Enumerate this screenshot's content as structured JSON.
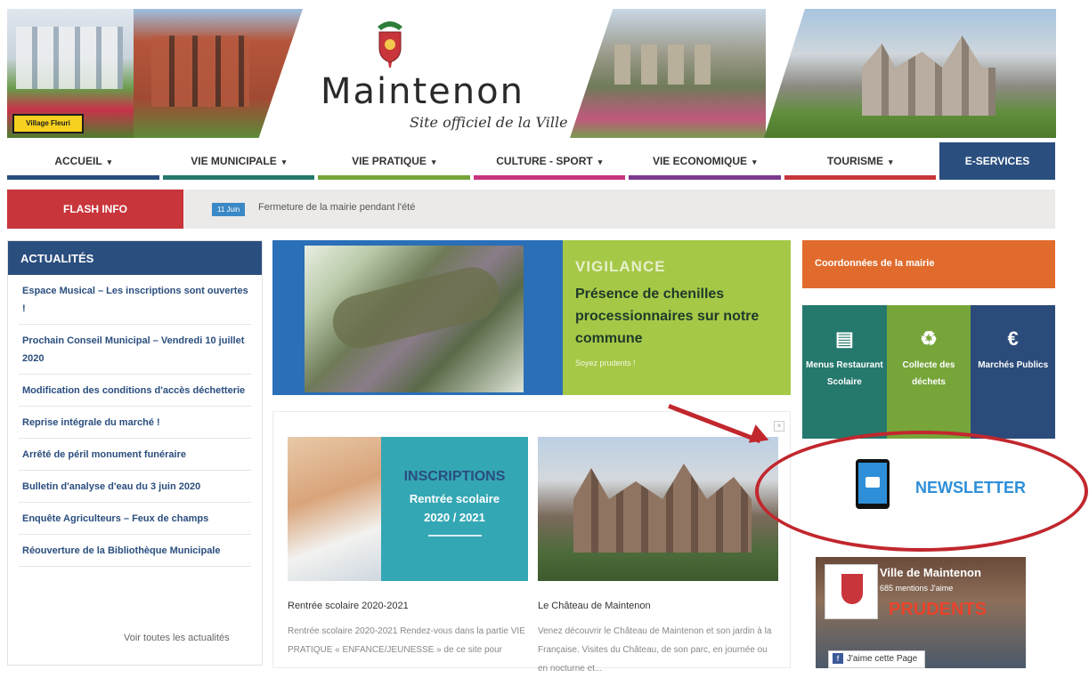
{
  "header": {
    "logo_title": "Maintenon",
    "logo_subtitle": "Site officiel de la Ville",
    "village_badge": "Village Fleuri"
  },
  "nav": [
    {
      "label": "ACCUEIL",
      "caret": "▾",
      "color": "#2a4e7e"
    },
    {
      "label": "VIE MUNICIPALE",
      "caret": "▾",
      "color": "#24786c"
    },
    {
      "label": "VIE PRATIQUE",
      "caret": "▾",
      "color": "#77a53a"
    },
    {
      "label": "CULTURE - SPORT",
      "caret": "▾",
      "color": "#c8357e"
    },
    {
      "label": "VIE ECONOMIQUE",
      "caret": "▾",
      "color": "#7a3a8e"
    },
    {
      "label": "TOURISME",
      "caret": "▾",
      "color": "#c8353b"
    },
    {
      "label": "E-SERVICES",
      "caret": "",
      "color": "#2a4e7e"
    }
  ],
  "flash": {
    "label": "FLASH INFO",
    "date": "11 Juin",
    "text": "Fermeture de la mairie pendant l'été"
  },
  "actualites": {
    "title": "ACTUALITÉS",
    "items": [
      "Espace Musical – Les inscriptions sont ouvertes !",
      "Prochain Conseil Municipal – Vendredi 10 juillet 2020",
      "Modification des conditions d'accès déchetterie",
      "Reprise intégrale du marché !",
      "Arrêté de péril monument funéraire",
      "Bulletin d'analyse d'eau du 3 juin 2020",
      "Enquête Agriculteurs – Feux de champs",
      "Réouverture de la Bibliothèque Municipale"
    ],
    "see_all": "Voir toutes les actualités"
  },
  "vigilance": {
    "kicker": "VIGILANCE",
    "title": "Présence de chenilles processionnaires sur notre commune",
    "cta": "Soyez prudents !"
  },
  "cards": [
    {
      "banner_title": "INSCRIPTIONS",
      "banner_sub1": "Rentrée scolaire",
      "banner_sub2": "2020 / 2021",
      "title": "Rentrée scolaire 2020-2021",
      "text": "Rentrée scolaire 2020-2021 Rendez-vous dans la partie VIE PRATIQUE « ENFANCE/JEUNESSE » de ce site pour"
    },
    {
      "title": "Le Château de Maintenon",
      "text": "Venez découvrir le Château de Maintenon et son jardin à la Française. Visites du Château, de son parc, en journée ou en nocturne et..."
    }
  ],
  "right": {
    "coord": "Coordonnées de la mairie",
    "tiles": [
      {
        "icon": "▤",
        "icon_name": "menu-card-icon",
        "label": "Menus Restaurant Scolaire"
      },
      {
        "icon": "♻",
        "icon_name": "recycle-icon",
        "label": "Collecte des déchets"
      },
      {
        "icon": "€",
        "icon_name": "euro-icon",
        "label": "Marchés Publics"
      }
    ],
    "newsletter": "NEWSLETTER",
    "facebook": {
      "page_name": "Ville de Maintenon",
      "likes": "685 mentions J'aime",
      "overlay": "PRUDENTS",
      "like_button": "J'aime cette Page",
      "f_glyph": "f"
    }
  }
}
